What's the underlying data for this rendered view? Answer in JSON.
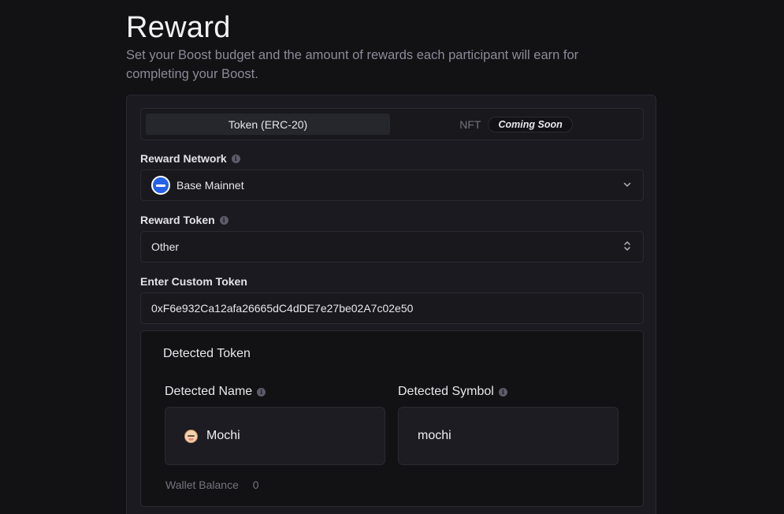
{
  "header": {
    "title": "Reward",
    "subtitle": "Set your Boost budget and the amount of rewards each participant will earn for completing your Boost."
  },
  "tabs": {
    "token_label": "Token (ERC-20)",
    "nft_label": "NFT",
    "nft_badge": "Coming Soon"
  },
  "network": {
    "label": "Reward Network",
    "value": "Base Mainnet",
    "icon": "base-network-icon"
  },
  "token": {
    "label": "Reward Token",
    "value": "Other"
  },
  "custom_token": {
    "label": "Enter Custom Token",
    "value": "0xF6e932Ca12afa26665dC4dDE7e27be02A7c02e50"
  },
  "detected": {
    "title": "Detected Token",
    "name_label": "Detected Name",
    "name_value": "Mochi",
    "symbol_label": "Detected Symbol",
    "symbol_value": "mochi",
    "wallet_label": "Wallet Balance",
    "wallet_value": "0"
  },
  "colors": {
    "background": "#121214",
    "card": "#1a1a20",
    "accent_blue": "#2461e6"
  }
}
